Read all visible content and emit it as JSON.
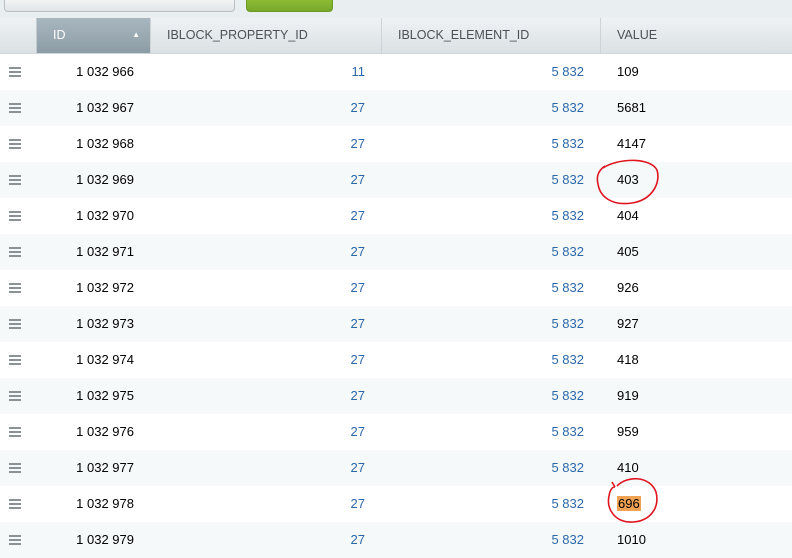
{
  "table": {
    "columns": [
      "ID",
      "IBLOCK_PROPERTY_ID",
      "IBLOCK_ELEMENT_ID",
      "VALUE"
    ],
    "sorted_column": "ID",
    "sort_direction": "ascending",
    "rows": [
      {
        "id": "1 032 966",
        "property_id": "11",
        "element_id": "5 832",
        "value": "109"
      },
      {
        "id": "1 032 967",
        "property_id": "27",
        "element_id": "5 832",
        "value": "5681"
      },
      {
        "id": "1 032 968",
        "property_id": "27",
        "element_id": "5 832",
        "value": "4147"
      },
      {
        "id": "1 032 969",
        "property_id": "27",
        "element_id": "5 832",
        "value": "403"
      },
      {
        "id": "1 032 970",
        "property_id": "27",
        "element_id": "5 832",
        "value": "404"
      },
      {
        "id": "1 032 971",
        "property_id": "27",
        "element_id": "5 832",
        "value": "405"
      },
      {
        "id": "1 032 972",
        "property_id": "27",
        "element_id": "5 832",
        "value": "926"
      },
      {
        "id": "1 032 973",
        "property_id": "27",
        "element_id": "5 832",
        "value": "927"
      },
      {
        "id": "1 032 974",
        "property_id": "27",
        "element_id": "5 832",
        "value": "418"
      },
      {
        "id": "1 032 975",
        "property_id": "27",
        "element_id": "5 832",
        "value": "919"
      },
      {
        "id": "1 032 976",
        "property_id": "27",
        "element_id": "5 832",
        "value": "959"
      },
      {
        "id": "1 032 977",
        "property_id": "27",
        "element_id": "5 832",
        "value": "410"
      },
      {
        "id": "1 032 978",
        "property_id": "27",
        "element_id": "5 832",
        "value": "696",
        "highlighted": true
      },
      {
        "id": "1 032 979",
        "property_id": "27",
        "element_id": "5 832",
        "value": "1010"
      }
    ]
  },
  "icons": {
    "row_menu": "hamburger-menu-icon",
    "sort": "sort-ascending-icon"
  },
  "annotations": {
    "circled_values": [
      "403",
      "696"
    ],
    "annotation_color": "#e0141e"
  },
  "colors": {
    "link": "#2a67a8",
    "highlight": "#f0a254",
    "sorted_header": "#97a7b0",
    "toolbar_button_green": "#8bbb33"
  }
}
